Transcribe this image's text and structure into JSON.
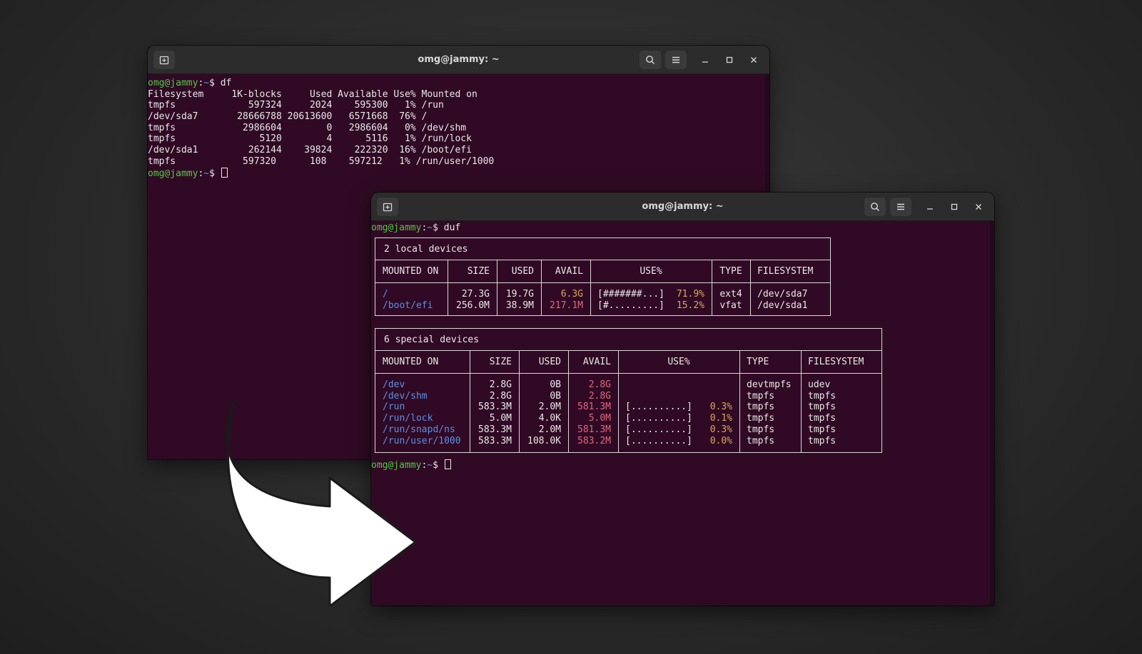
{
  "window_back": {
    "title": "omg@jammy: ~",
    "command_prompt": {
      "user": "omg@jammy",
      "sep": ":",
      "path": "~",
      "dollar": "$",
      "command": " df"
    },
    "df_header": "Filesystem     1K-blocks     Used Available Use% Mounted on",
    "df_rows": [
      "tmpfs             597324     2024    595300   1% /run",
      "/dev/sda7       28666788 20613600   6571668  76% /",
      "tmpfs            2986604        0   2986604   0% /dev/shm",
      "tmpfs               5120        4      5116   1% /run/lock",
      "/dev/sda1         262144    39824    222320  16% /boot/efi",
      "tmpfs            597320      108    597212   1% /run/user/1000"
    ],
    "end_prompt": {
      "user": "omg@jammy",
      "sep": ":",
      "path": "~",
      "dollar": "$ "
    }
  },
  "window_front": {
    "title": "omg@jammy: ~",
    "command_prompt": {
      "user": "omg@jammy",
      "sep": ":",
      "path": "~",
      "dollar": "$",
      "command": " duf"
    },
    "local": {
      "caption": "2 local devices",
      "headers": [
        "MOUNTED ON",
        "SIZE",
        "USED",
        "AVAIL",
        "USE%",
        "TYPE",
        "FILESYSTEM"
      ],
      "rows": [
        {
          "mount": "/",
          "size": "27.3G",
          "used": "19.7G",
          "avail": "6.3G",
          "bar": "[#######...]",
          "pct": "71.9%",
          "type": "ext4",
          "fs": "/dev/sda7"
        },
        {
          "mount": "/boot/efi",
          "size": "256.0M",
          "used": "38.9M",
          "avail": "217.1M",
          "bar": "[#.........]",
          "pct": "15.2%",
          "type": "vfat",
          "fs": "/dev/sda1"
        }
      ]
    },
    "special": {
      "caption": "6 special devices",
      "headers": [
        "MOUNTED ON",
        "SIZE",
        "USED",
        "AVAIL",
        "USE%",
        "TYPE",
        "FILESYSTEM"
      ],
      "rows": [
        {
          "mount": "/dev",
          "size": "2.8G",
          "used": "0B",
          "avail": "2.8G",
          "bar": "",
          "pct": "",
          "type": "devtmpfs",
          "fs": "udev"
        },
        {
          "mount": "/dev/shm",
          "size": "2.8G",
          "used": "0B",
          "avail": "2.8G",
          "bar": "",
          "pct": "",
          "type": "tmpfs",
          "fs": "tmpfs"
        },
        {
          "mount": "/run",
          "size": "583.3M",
          "used": "2.0M",
          "avail": "581.3M",
          "bar": "[..........]",
          "pct": "0.3%",
          "type": "tmpfs",
          "fs": "tmpfs"
        },
        {
          "mount": "/run/lock",
          "size": "5.0M",
          "used": "4.0K",
          "avail": "5.0M",
          "bar": "[..........]",
          "pct": "0.1%",
          "type": "tmpfs",
          "fs": "tmpfs"
        },
        {
          "mount": "/run/snapd/ns",
          "size": "583.3M",
          "used": "2.0M",
          "avail": "581.3M",
          "bar": "[..........]",
          "pct": "0.3%",
          "type": "tmpfs",
          "fs": "tmpfs"
        },
        {
          "mount": "/run/user/1000",
          "size": "583.3M",
          "used": "108.0K",
          "avail": "583.2M",
          "bar": "[..........]",
          "pct": "0.0%",
          "type": "tmpfs",
          "fs": "tmpfs"
        }
      ]
    },
    "end_prompt": {
      "user": "omg@jammy",
      "sep": ":",
      "path": "~",
      "dollar": "$ "
    }
  },
  "icons": {
    "new_tab": "new-tab-icon",
    "search": "search-icon",
    "menu": "hamburger-menu-icon",
    "minimize": "minimize-icon",
    "maximize": "maximize-icon",
    "close": "close-icon",
    "arrow": "curved-arrow-icon"
  },
  "colors": {
    "terminal_bg": "#300a24",
    "prompt_user": "#4ec940",
    "prompt_path": "#5b8fe6",
    "mount_blue": "#5b8fe6",
    "avail_yellow": "#d6a85a",
    "avail_pink": "#e0677e"
  }
}
